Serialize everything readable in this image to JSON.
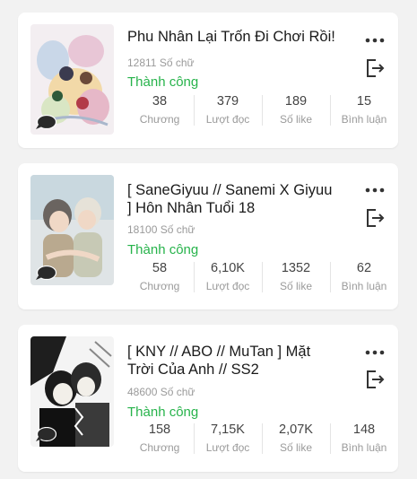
{
  "stories": [
    {
      "title": "Phu Nhân Lại Trốn Đi Chơi Rồi!",
      "words": "12811 Số chữ",
      "status": "Thành công",
      "stats": [
        {
          "value": "38",
          "label": "Chương"
        },
        {
          "value": "379",
          "label": "Lượt đọc"
        },
        {
          "value": "189",
          "label": "Số like"
        },
        {
          "value": "15",
          "label": "Bình luận"
        }
      ]
    },
    {
      "title": "[ SaneGiyuu // Sanemi X Giyuu ] Hôn Nhân Tuổi 18",
      "words": "18100 Số chữ",
      "status": "Thành công",
      "stats": [
        {
          "value": "58",
          "label": "Chương"
        },
        {
          "value": "6,10K",
          "label": "Lượt đọc"
        },
        {
          "value": "1352",
          "label": "Số like"
        },
        {
          "value": "62",
          "label": "Bình luận"
        }
      ]
    },
    {
      "title": "[ KNY // ABO // MuTan ] Mặt Trời Của Anh // SS2",
      "words": "48600 Số chữ",
      "status": "Thành công",
      "stats": [
        {
          "value": "158",
          "label": "Chương"
        },
        {
          "value": "7,15K",
          "label": "Lượt đọc"
        },
        {
          "value": "2,07K",
          "label": "Số like"
        },
        {
          "value": "148",
          "label": "Bình luận"
        }
      ]
    }
  ],
  "icons": {
    "more": "more-vertical-dots-icon",
    "exit": "exit-icon",
    "comment": "comment-bubble-icon"
  },
  "colors": {
    "status": "#27b34b",
    "background": "#f2f2f2"
  }
}
